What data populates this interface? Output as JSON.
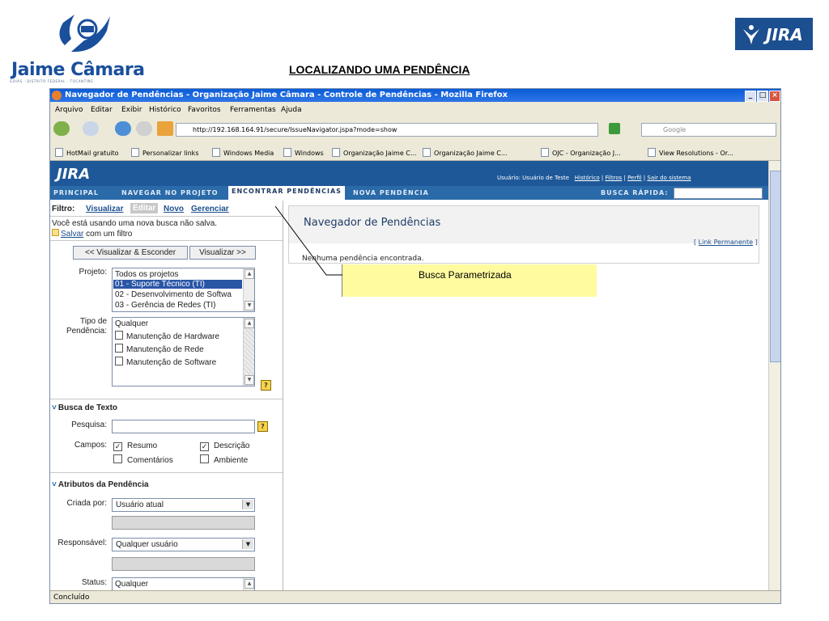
{
  "slide": {
    "title": "LOCALIZANDO UMA PENDÊNCIA",
    "logo_left_name": "Jaime Câmara",
    "logo_left_sub": "GOIÁS · DISTRITO FEDERAL · TOCANTINS",
    "logo_right": "JIRA"
  },
  "browser": {
    "title": "Navegador de Pendências - Organização Jaime Câmara - Controle de Pendências - Mozilla Firefox",
    "menu": [
      "Arquivo",
      "Editar",
      "Exibir",
      "Histórico",
      "Favoritos",
      "Ferramentas",
      "Ajuda"
    ],
    "url": "http://192.168.164.91/secure/IssueNavigator.jspa?mode=show",
    "search_placeholder": "Google",
    "bookmarks": [
      "HotMail gratuito",
      "Personalizar links",
      "Windows Media",
      "Windows",
      "Organização Jaime C...",
      "Organização Jaime C...",
      "OJC - Organização J...",
      "View Resolutions - Or..."
    ],
    "status": "Concluído",
    "window_buttons": [
      "_",
      "□",
      "×"
    ]
  },
  "jira": {
    "logo": "JIRA",
    "user_prefix": "Usuário: Usuário de Teste",
    "user_links": [
      "Histórico",
      "Filtros",
      "Perfil",
      "Sair do sistema"
    ],
    "nav": [
      "PRINCIPAL",
      "NAVEGAR NO PROJETO",
      "ENCONTRAR PENDÊNCIAS",
      "NOVA PENDÊNCIA"
    ],
    "quick_search_label": "BUSCA RÁPIDA:",
    "filter": {
      "label": "Filtro:",
      "tabs": [
        "Visualizar",
        "Editar",
        "Novo",
        "Gerenciar"
      ],
      "info": "Você está usando uma nova busca não salva.",
      "save_link": "Salvar",
      "save_suffix": " com um filtro"
    },
    "buttons": {
      "hide": "<< Visualizar & Esconder",
      "view": "Visualizar >>"
    },
    "project": {
      "label": "Projeto:",
      "options": [
        "Todos os projetos",
        "01 - Suporte Técnico (TI)",
        "02 - Desenvolvimento de Softwa",
        "03 - Gerência de Redes (TI)"
      ]
    },
    "issue_type": {
      "label_line1": "Tipo de",
      "label_line2": "Pendência:",
      "options": [
        "Qualquer",
        "Manutenção de Hardware",
        "Manutenção de Rede",
        "Manutenção de Software"
      ]
    },
    "text_search": {
      "header": "Busca de Texto",
      "search_label": "Pesquisa:",
      "fields_label": "Campos:",
      "checks": [
        {
          "label": "Resumo",
          "checked": true
        },
        {
          "label": "Descrição",
          "checked": true
        },
        {
          "label": "Comentários",
          "checked": false
        },
        {
          "label": "Ambiente",
          "checked": false
        }
      ]
    },
    "attributes": {
      "header": "Atributos da Pendência",
      "created_label": "Criada por:",
      "created_value": "Usuário atual",
      "assignee_label": "Responsável:",
      "assignee_value": "Qualquer usuário",
      "status_label": "Status:",
      "status_value": "Qualquer"
    },
    "main": {
      "title": "Navegador de Pendências",
      "permalink": "Link Permanente",
      "no_results": "Nenhuma pendência encontrada."
    }
  },
  "callout": {
    "text": "Busca Parametrizada"
  },
  "colors": {
    "jira_blue": "#1e5898",
    "callout": "#fffb9e",
    "link": "#1c4f8f"
  }
}
